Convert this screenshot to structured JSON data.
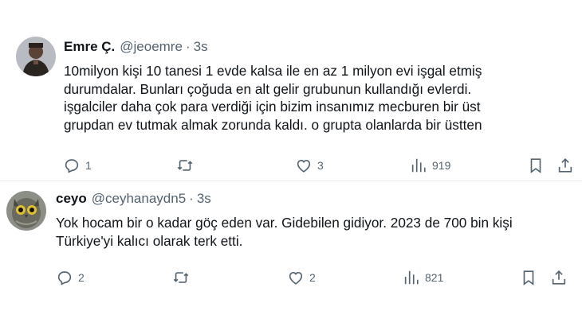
{
  "tweets": [
    {
      "author": {
        "name": "Emre Ç.",
        "handle": "@jeoemre",
        "separator": "·",
        "time": "3s"
      },
      "lines": [
        "10milyon kişi 10 tanesi 1 evde kalsa ile en az 1 milyon evi işgal etmiş",
        "durumdalar. Bunları çoğuda en alt gelir grubunun kullandığı evlerdi.",
        "işgalciler daha çok para verdiği için bizim insanımız mecburen bir üst",
        "grupdan ev tutmak almak zorunda kaldı. o grupta olanlarda bir üstten"
      ],
      "stats": {
        "replies": "1",
        "retweets": "",
        "likes": "3",
        "views": "919"
      },
      "icons": [
        "reply-icon",
        "retweet-icon",
        "like-icon",
        "views-icon",
        "bookmark-icon",
        "share-icon"
      ]
    },
    {
      "author": {
        "name": "ceyo",
        "handle": "@ceyhanaydn5",
        "separator": "·",
        "time": "3s"
      },
      "lines": [
        "Yok hocam bir o kadar göç eden var. Gidebilen gidiyor. 2023 de 700 bin kişi",
        "Türkiye'yi kalıcı olarak terk etti."
      ],
      "stats": {
        "replies": "2",
        "retweets": "",
        "likes": "2",
        "views": "821"
      },
      "icons": [
        "reply-icon",
        "retweet-icon",
        "like-icon",
        "views-icon",
        "bookmark-icon",
        "share-icon"
      ]
    }
  ],
  "colors": {
    "text": "#0f1419",
    "muted": "#536471",
    "divider": "#e6ecf0"
  }
}
